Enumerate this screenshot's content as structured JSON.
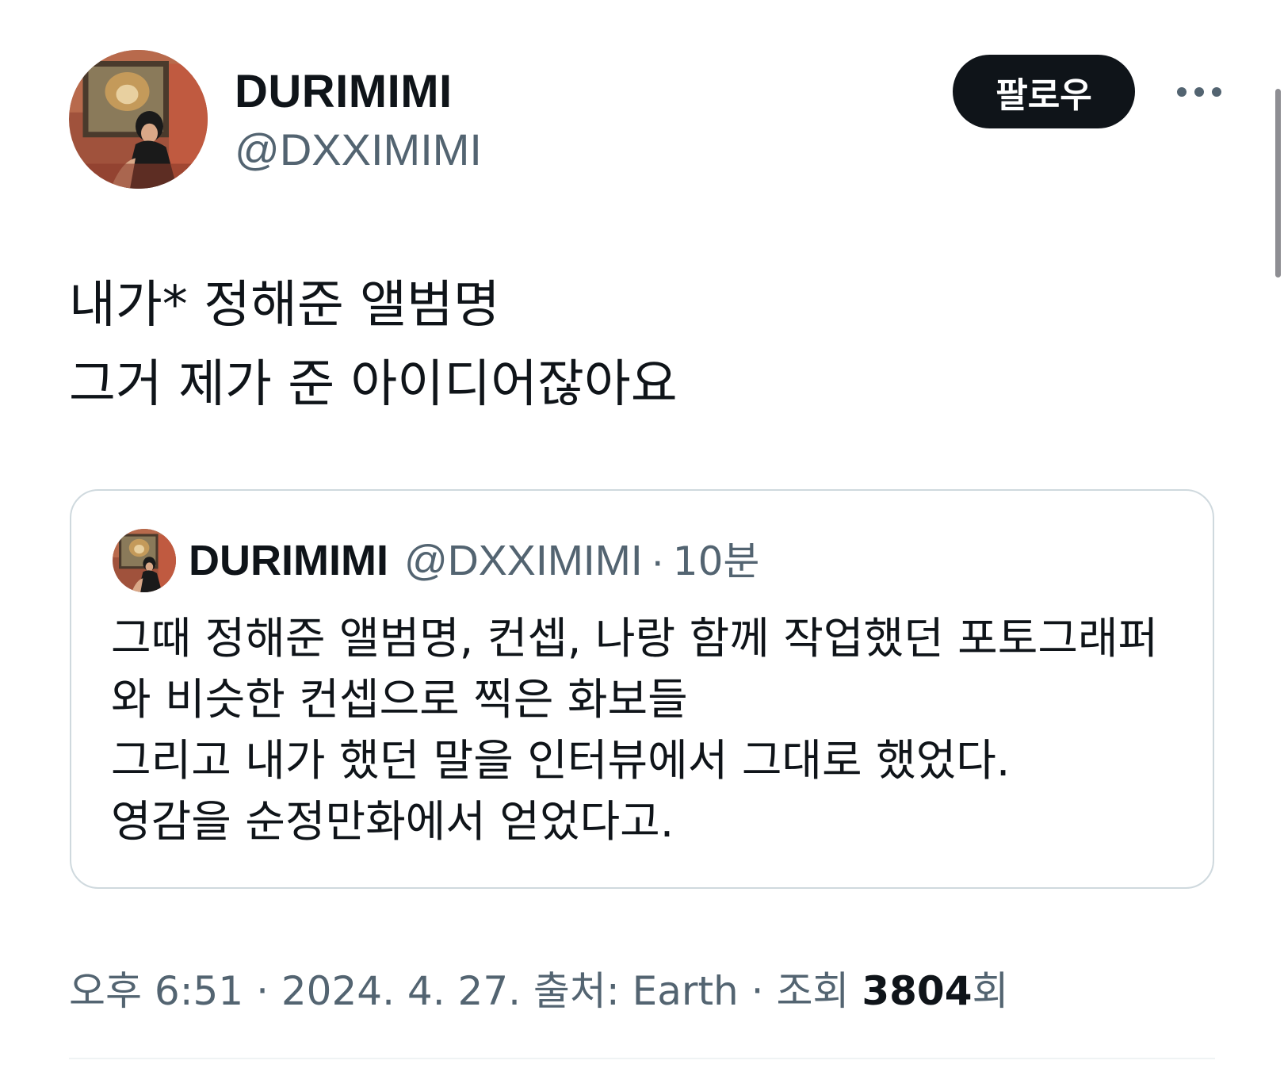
{
  "author": {
    "display_name": "DURIMIMI",
    "handle": "@DXXIMIMI",
    "avatar": "avatar-image"
  },
  "actions": {
    "follow_label": "팔로우",
    "more_icon": "more-options-icon"
  },
  "tweet": {
    "text": "내가* 정해준 앨범명\n그거 제가 준 아이디어잖아요"
  },
  "quoted_tweet": {
    "display_name": "DURIMIMI",
    "handle": "@DXXIMIMI",
    "separator": "·",
    "time_ago": "10분",
    "text": "그때 정해준 앨범명, 컨셉, 나랑 함께 작업했던 포토그래퍼\n와 비슷한 컨셉으로 찍은 화보들\n그리고 내가 했던 말을 인터뷰에서 그대로 했었다.\n영감을 순정만화에서 얻었다고."
  },
  "meta": {
    "time": "오후 6:51",
    "sep1": " · ",
    "date": "2024. 4. 27.",
    "source": " 출처: Earth",
    "sep2": " · ",
    "views_label": "조회 ",
    "views_count": "3804",
    "views_suffix": "회"
  },
  "colors": {
    "text_primary": "#0f1419",
    "text_secondary": "#536471",
    "border": "#cfd9de",
    "button_bg": "#0f1419"
  }
}
